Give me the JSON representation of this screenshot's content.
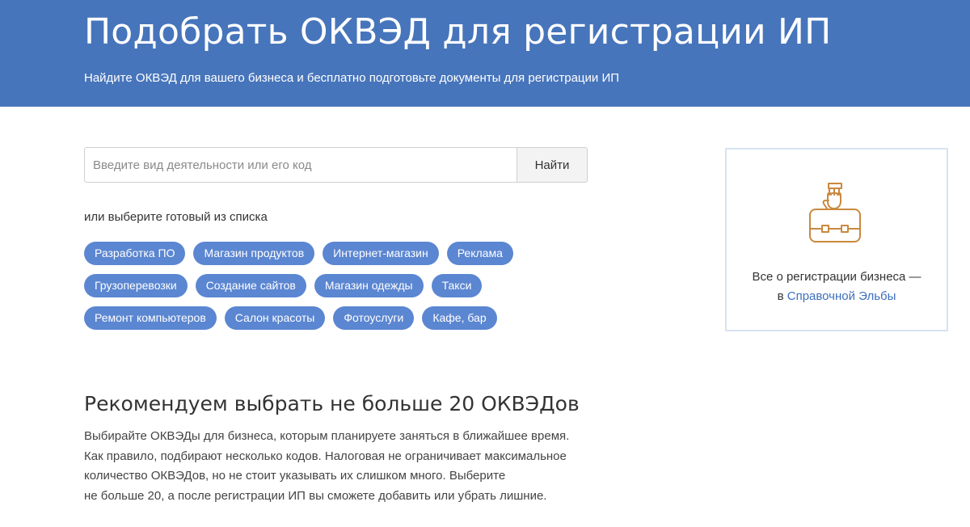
{
  "header": {
    "title": "Подобрать ОКВЭД для регистрации ИП",
    "subtitle": "Найдите ОКВЭД для вашего бизнеса и бесплатно подготовьте документы для регистрации ИП"
  },
  "search": {
    "placeholder": "Введите вид деятельности или его код",
    "value": "",
    "button_label": "Найти"
  },
  "hint": "или выберите готовый из списка",
  "tags": {
    "row1": [
      "Разработка ПО",
      "Магазин продуктов",
      "Интернет-магазин",
      "Реклама"
    ],
    "row2": [
      "Грузоперевозки",
      "Создание сайтов",
      "Магазин одежды",
      "Такси"
    ],
    "row3": [
      "Ремонт компьютеров",
      "Салон красоты",
      "Фотоуслуги",
      "Кафе, бар"
    ]
  },
  "card": {
    "icon": "briefcase-hand-icon",
    "line1": "Все о регистрации бизнеса —",
    "line2_prefix": "в ",
    "link_text": "Справочной Эльбы"
  },
  "recommendation": {
    "title": "Рекомендуем выбрать не больше 20 ОКВЭДов",
    "lines": [
      "Выбирайте ОКВЭДы для бизнеса, которым планируете заняться в ближайшее время.",
      "Как правило, подбирают несколько кодов. Налоговая не ограничивает максимальное",
      "количество ОКВЭДов, но не стоит указывать их слишком много. Выберите",
      "не больше 20, а после регистрации ИП вы сможете добавить или убрать лишние."
    ]
  },
  "colors": {
    "header_bg": "#4775bb",
    "tag_bg": "#5b86d1",
    "link": "#3c6fbd",
    "icon_stroke": "#c9893e"
  }
}
